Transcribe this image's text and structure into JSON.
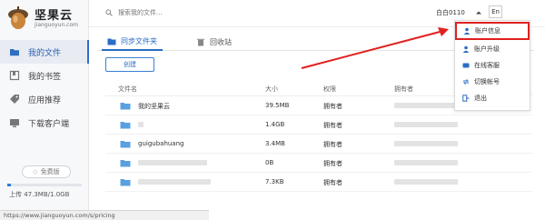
{
  "app": {
    "logo_name": "坚果云",
    "logo_domain": "jianguoyun.com"
  },
  "sidebar": {
    "items": [
      {
        "label": "我的文件",
        "icon": "folder-icon",
        "active": true
      },
      {
        "label": "我的书签",
        "icon": "bookmark-icon",
        "active": false
      },
      {
        "label": "应用推荐",
        "icon": "tag-icon",
        "active": false
      },
      {
        "label": "下载客户端",
        "icon": "monitor-icon",
        "active": false
      }
    ],
    "plan_badge": "免费版",
    "storage_text": "上传 47.3MB/1.0GB",
    "storage_used_fraction": 0.046
  },
  "header": {
    "search_placeholder": "搜索我的文件...",
    "user_name": "白白0110",
    "lang_button": "En"
  },
  "tabs": [
    {
      "label": "同步文件夹",
      "icon": "folder-icon",
      "active": true
    },
    {
      "label": "回收站",
      "icon": "trash-icon",
      "active": false
    }
  ],
  "toolbar": {
    "new_button": "创建"
  },
  "table": {
    "headers": [
      "文件名",
      "大小",
      "权限",
      "拥有者"
    ],
    "rows": [
      {
        "name": "我的坚果云",
        "size": "39.5MB",
        "perm": "拥有者"
      },
      {
        "name": "",
        "size": "1.4GB",
        "perm": "拥有者"
      },
      {
        "name": "guigubahuang",
        "size": "3.4MB",
        "perm": "拥有者"
      },
      {
        "name": "",
        "size": "0B",
        "perm": "拥有者"
      },
      {
        "name": "",
        "size": "7.3KB",
        "perm": "拥有者"
      }
    ]
  },
  "menu": {
    "items": [
      {
        "label": "账户信息",
        "icon": "user-icon",
        "highlighted": true
      },
      {
        "label": "账户升级",
        "icon": "user-upgrade-icon",
        "highlighted": false
      },
      {
        "label": "在线客服",
        "icon": "support-icon",
        "highlighted": false
      },
      {
        "label": "切换帐号",
        "icon": "switch-account-icon",
        "highlighted": false
      },
      {
        "label": "退出",
        "icon": "logout-icon",
        "highlighted": false
      }
    ]
  },
  "statusbar": {
    "url": "https://www.jianguoyun.com/s/pricing"
  },
  "colors": {
    "accent": "#2a6dc4",
    "annotation": "#e02020"
  }
}
